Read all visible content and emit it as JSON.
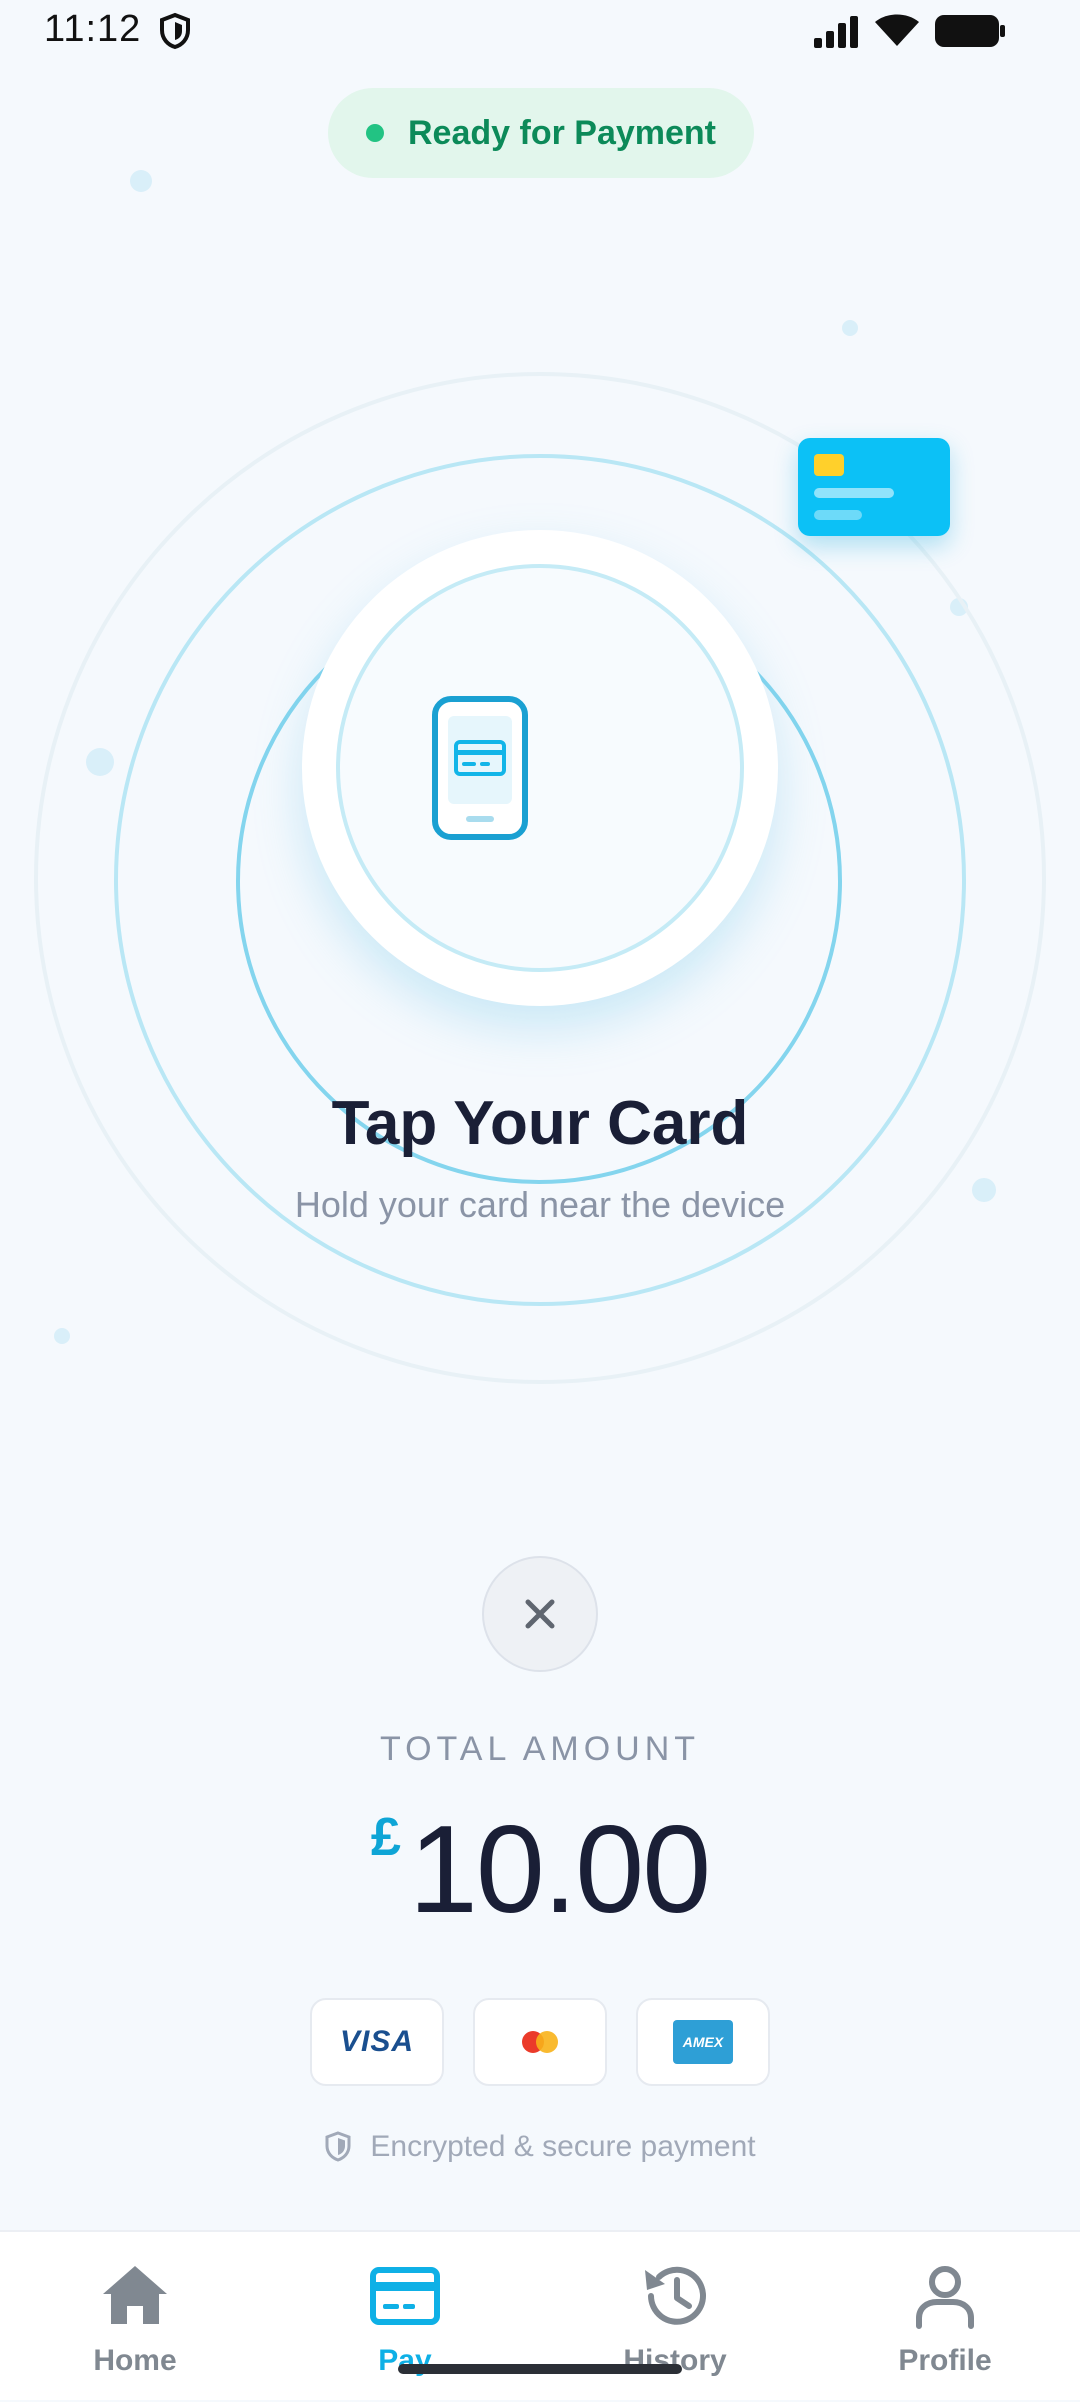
{
  "status_bar": {
    "time": "11:12"
  },
  "status_pill": {
    "label": "Ready for Payment",
    "dot_color": "#22c383"
  },
  "prompt": {
    "title": "Tap Your Card",
    "subtitle": "Hold your card near the device"
  },
  "payment": {
    "total_label": "TOTAL AMOUNT",
    "currency_symbol": "£",
    "amount": "10.00"
  },
  "card_brands": {
    "visa": "VISA",
    "mastercard": "Mastercard",
    "amex": "AMEX"
  },
  "security": {
    "text": "Encrypted & secure payment"
  },
  "nav": {
    "items": [
      {
        "label": "Home",
        "icon": "home-icon",
        "active": false
      },
      {
        "label": "Pay",
        "icon": "card-icon",
        "active": true
      },
      {
        "label": "History",
        "icon": "history-icon",
        "active": false
      },
      {
        "label": "Profile",
        "icon": "profile-icon",
        "active": false
      }
    ]
  },
  "colors": {
    "accent": "#0eb0e6",
    "success": "#22c383",
    "card": "#0cc1f6"
  }
}
